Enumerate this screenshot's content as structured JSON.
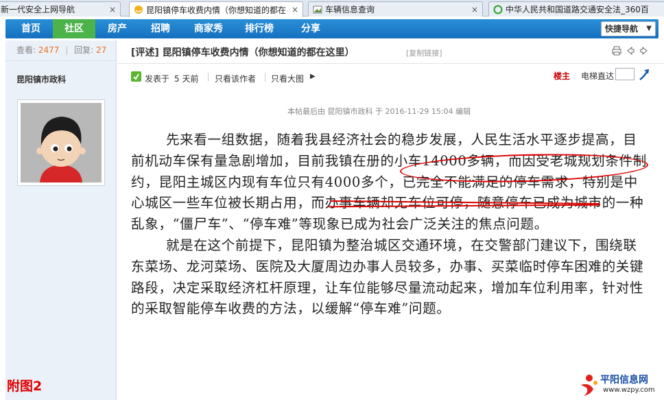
{
  "tabs": [
    {
      "title": "新一代安全上网导航",
      "close": "×",
      "icon": "navigation-icon"
    },
    {
      "title": "昆阳镇停车收费内情（你想知道的都在",
      "close": "×",
      "icon": "forum-icon"
    },
    {
      "title": "车辆信息查询",
      "close": "×",
      "icon": "image-icon"
    },
    {
      "title": "中华人民共和国道路交通安全法_360百",
      "close": "",
      "icon": "search-360-icon"
    }
  ],
  "nav": {
    "items": [
      "首页",
      "社区",
      "房产",
      "招聘",
      "商家秀",
      "排行榜",
      "分享"
    ],
    "active": "社区",
    "quick_nav": "快捷导航"
  },
  "author": {
    "views_label": "查看:",
    "views": "2477",
    "replies_label": "回复:",
    "replies": "27",
    "name": "昆阳镇市政科"
  },
  "post": {
    "title": "[评述] 昆阳镇停车收费内情（你想知道的都在这里）",
    "copy_link": "[复制链接]",
    "posted_label": "发表于",
    "posted_time": "5 天前",
    "only_author": "只看该作者",
    "large_image": "只看大图",
    "floor": "楼主",
    "elevator": "电梯直达",
    "last_edit": "本帖最后由 昆阳镇市政科 于 2016-11-29 15:04 编辑"
  },
  "body": {
    "p1_a": "先来看一组数据，随着我县经济社会的稳步发展，人民生活水平逐步提高，目前机动车保有量急剧增加，",
    "p1_hl1": "目前我镇在册的小车14000多辆",
    "p1_b": "，而因受老城规划条件制约，",
    "p1_hl2": "昆阳主城区内现有车位只有4000多个",
    "p1_c": "，已完全不能满足的停车需求，特别是中心城区一些车位被长期占用，而办事车辆却无车位可停，随意停车已成为城市的一种乱象，“僵尸车”、“停车难”等现象已成为社会广泛关注的焦点问题。",
    "p2": "就是在这个前提下，昆阳镇为整治城区交通环境，在交警部门建议下，围绕联东菜场、龙河菜场、医院及大厦周边办事人员较多，办事、买菜临时停车困难的关键路段，决定采取经济杠杆原理，让车位能够尽量流动起来，增加车位利用率，针对性的采取智能停车收费的方法，以缓解“停车难”问题。"
  },
  "figure_label": "附图2",
  "watermark": {
    "name": "平阳信息网",
    "url": "www.wzpy.com"
  },
  "colors": {
    "nav_blue": "#1a7ccc",
    "nav_active": "#4cb24a",
    "highlight_red": "#d00000"
  }
}
